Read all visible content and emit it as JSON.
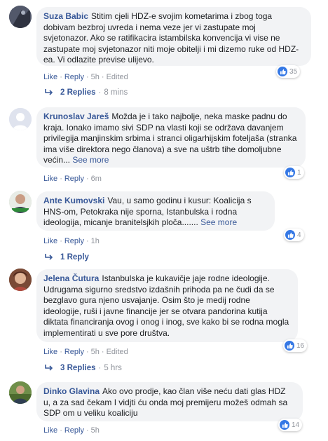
{
  "comments": [
    {
      "author": "Suza Babic",
      "text": "Stitim cjeli HDZ-e svojim kometarima i zbog toga dobivam bezbroj uvreda i nema veze jer vi zastupate moj svjetonazor. Ako se ratifikacira istambilska konvencija vi vise ne zastupate moj svjetonazor niti moje obitelji i mi dizemo ruke od HDZ-ea. Vi odlazite previse ulijevo.",
      "see_more": "",
      "like_label": "Like",
      "reply_label": "Reply",
      "time": "5h",
      "edited": "Edited",
      "reactions": "35",
      "replies_label": "2 Replies",
      "replies_time": "8 mins"
    },
    {
      "author": "Krunoslav Jareš",
      "text": "Možda je i tako najbolje, neka maske padnu do kraja. Ionako imamo sivi SDP na vlasti koji se održava davanjem privilegija manjinskim srbima i stranci oligarhijskim foteljaša (stranka ima više direktora nego članova) a sve na uštrb tihe domoljubne većin...",
      "see_more": "See more",
      "like_label": "Like",
      "reply_label": "Reply",
      "time": "6m",
      "edited": "",
      "reactions": "1",
      "replies_label": "",
      "replies_time": ""
    },
    {
      "author": "Ante Kumovski",
      "text": "Vau, u samo godinu i kusur: Koalicija s HNS-om, Petokraka nije sporna, Istanbulska i rodna ideologija, micanje branitelsjkih ploča.......",
      "see_more": "See more",
      "like_label": "Like",
      "reply_label": "Reply",
      "time": "1h",
      "edited": "",
      "reactions": "4",
      "replies_label": "1 Reply",
      "replies_time": ""
    },
    {
      "author": "Jelena Čutura",
      "text": "Istanbulska je kukavičje jaje rodne ideologije. Udrugama sigurno sredstvo izdašnih prihoda pa ne čudi da se bezglavo gura njeno usvajanje. Osim što je medij rodne ideologije, ruši i javne financije jer se otvara pandorina kutija diktata financiranja ovog i onog i inog, sve kako bi se rodna mogla implementirati u sve pore društva.",
      "see_more": "",
      "like_label": "Like",
      "reply_label": "Reply",
      "time": "5h",
      "edited": "Edited",
      "reactions": "16",
      "replies_label": "3 Replies",
      "replies_time": "5 hrs"
    },
    {
      "author": "Dinko Glavina",
      "text": "Ako ovo prodje, kao član više neću dati glas HDZ u, a za sad čekam I vidjti ću onda moj premijeru možeš odmah sa SDP om u veliku koaliciju",
      "see_more": "",
      "like_label": "Like",
      "reply_label": "Reply",
      "time": "5h",
      "edited": "",
      "reactions": "14",
      "replies_label": "",
      "replies_time": ""
    }
  ],
  "colors": {
    "link": "#385898",
    "meta": "#90949c",
    "bubble": "#f2f3f5",
    "like_blue": "#3578e5"
  }
}
